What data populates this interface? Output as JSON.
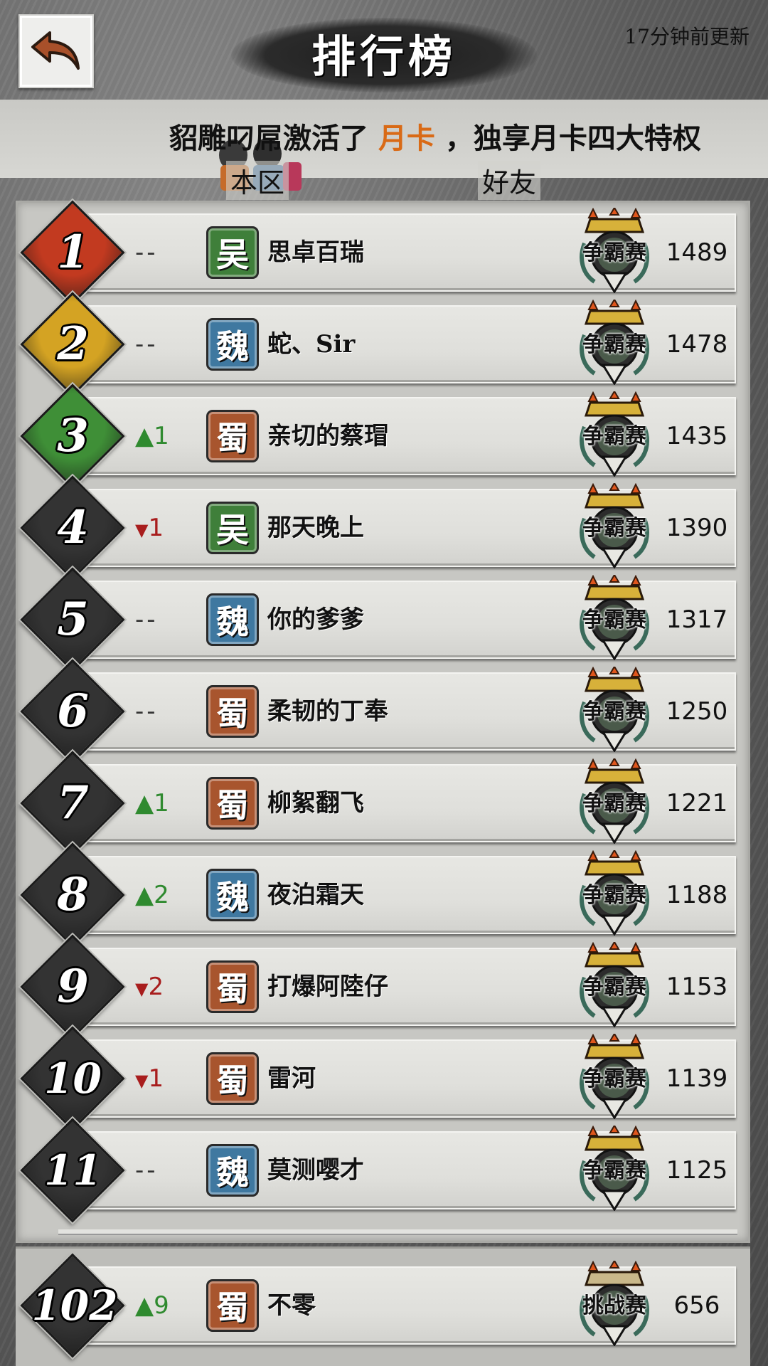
{
  "header": {
    "title": "排行榜",
    "update_time": "17分钟前更新",
    "back_icon": "back-arrow-icon"
  },
  "notice": {
    "prefix": "貂雕叼屌激活了",
    "highlight": "月卡",
    "suffix": "，独享月卡四大特权",
    "highlight_color": "#d96a16"
  },
  "tabs": [
    {
      "label": "本区",
      "selected": true
    },
    {
      "label": "好友",
      "selected": false
    }
  ],
  "colors": {
    "rank1": "#c23a20",
    "rank2": "#d4a323",
    "rank3": "#3f8f37",
    "rank_other": "#333333",
    "faction_wu": "#3f7f3a",
    "faction_wei": "#3f78a0",
    "faction_shu": "#a8552e",
    "up": "#2f8a2f",
    "down": "#a81d1d"
  },
  "rows": [
    {
      "rank": "1",
      "change_dir": "same",
      "change": "-- ",
      "faction": "吴",
      "faction_key": "wu",
      "name": "思卓百瑞",
      "badge": "争霸赛",
      "score": "1489"
    },
    {
      "rank": "2",
      "change_dir": "same",
      "change": "-- ",
      "faction": "魏",
      "faction_key": "wei",
      "name": "蛇、Sir",
      "badge": "争霸赛",
      "score": "1478"
    },
    {
      "rank": "3",
      "change_dir": "up",
      "change": "1",
      "faction": "蜀",
      "faction_key": "shu",
      "name": "亲切的蔡瑁",
      "badge": "争霸赛",
      "score": "1435"
    },
    {
      "rank": "4",
      "change_dir": "down",
      "change": "1",
      "faction": "吴",
      "faction_key": "wu",
      "name": "那天晚上",
      "badge": "争霸赛",
      "score": "1390"
    },
    {
      "rank": "5",
      "change_dir": "same",
      "change": "-- ",
      "faction": "魏",
      "faction_key": "wei",
      "name": "你的爹爹",
      "badge": "争霸赛",
      "score": "1317"
    },
    {
      "rank": "6",
      "change_dir": "same",
      "change": "-- ",
      "faction": "蜀",
      "faction_key": "shu",
      "name": "柔韧的丁奉",
      "badge": "争霸赛",
      "score": "1250"
    },
    {
      "rank": "7",
      "change_dir": "up",
      "change": "1",
      "faction": "蜀",
      "faction_key": "shu",
      "name": "柳絮翻飞",
      "badge": "争霸赛",
      "score": "1221"
    },
    {
      "rank": "8",
      "change_dir": "up",
      "change": "2",
      "faction": "魏",
      "faction_key": "wei",
      "name": "夜泊霜天",
      "badge": "争霸赛",
      "score": "1188"
    },
    {
      "rank": "9",
      "change_dir": "down",
      "change": "2",
      "faction": "蜀",
      "faction_key": "shu",
      "name": "打爆阿陸仔",
      "badge": "争霸赛",
      "score": "1153"
    },
    {
      "rank": "10",
      "change_dir": "down",
      "change": "1",
      "faction": "蜀",
      "faction_key": "shu",
      "name": "雷河",
      "badge": "争霸赛",
      "score": "1139"
    },
    {
      "rank": "11",
      "change_dir": "same",
      "change": "-- ",
      "faction": "魏",
      "faction_key": "wei",
      "name": "莫测嘤才",
      "badge": "争霸赛",
      "score": "1125"
    }
  ],
  "self_row": {
    "rank": "102",
    "change_dir": "up",
    "change": "9",
    "faction": "蜀",
    "faction_key": "shu",
    "name": "不零",
    "badge": "挑战赛",
    "score": "656"
  }
}
